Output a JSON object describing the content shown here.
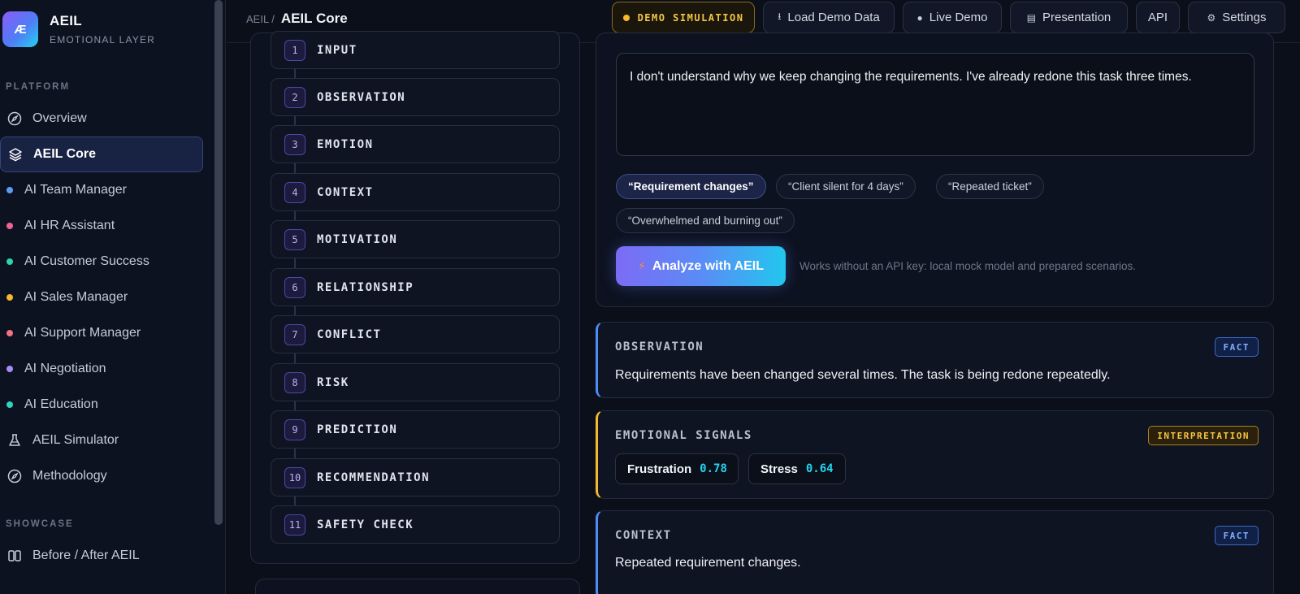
{
  "brand": {
    "logo_text": "Æ",
    "name": "AEIL",
    "subtitle": "EMOTIONAL LAYER"
  },
  "sidebar": {
    "platform_label": "PLATFORM",
    "platform_items": [
      {
        "label": "Overview",
        "icon": "compass-icon"
      },
      {
        "label": "AEIL Core",
        "icon": "layers-icon",
        "active": true
      },
      {
        "label": "AI Team Manager",
        "dot_color": "#5b9cf6"
      },
      {
        "label": "AI HR Assistant",
        "dot_color": "#f06292"
      },
      {
        "label": "AI Customer Success",
        "dot_color": "#2dd4a4"
      },
      {
        "label": "AI Sales Manager",
        "dot_color": "#f5b82e"
      },
      {
        "label": "AI Support Manager",
        "dot_color": "#f47283"
      },
      {
        "label": "AI Negotiation",
        "dot_color": "#a78bfa"
      },
      {
        "label": "AI Education",
        "dot_color": "#2dd4bf"
      },
      {
        "label": "AEIL Simulator",
        "icon": "flask-icon"
      },
      {
        "label": "Methodology",
        "icon": "compass-icon"
      }
    ],
    "showcase_label": "SHOWCASE",
    "showcase_items": [
      {
        "label": "Before / After AEIL",
        "icon": "split-columns-icon"
      }
    ]
  },
  "breadcrumb": {
    "parent": "AEIL",
    "separator": "/",
    "current": "AEIL Core"
  },
  "toolbar": {
    "demo_label": "DEMO SIMULATION",
    "load_label": "Load Demo Data",
    "live_label": "Live Demo",
    "presentation_label": "Presentation",
    "api_label": "API",
    "settings_label": "Settings"
  },
  "pipeline": {
    "steps": [
      {
        "num": "1",
        "label": "INPUT"
      },
      {
        "num": "2",
        "label": "OBSERVATION"
      },
      {
        "num": "3",
        "label": "EMOTION"
      },
      {
        "num": "4",
        "label": "CONTEXT"
      },
      {
        "num": "5",
        "label": "MOTIVATION"
      },
      {
        "num": "6",
        "label": "RELATIONSHIP"
      },
      {
        "num": "7",
        "label": "CONFLICT"
      },
      {
        "num": "8",
        "label": "RISK"
      },
      {
        "num": "9",
        "label": "PREDICTION"
      },
      {
        "num": "10",
        "label": "RECOMMENDATION"
      },
      {
        "num": "11",
        "label": "SAFETY CHECK"
      }
    ]
  },
  "input": {
    "message": "I don't understand why we keep changing the requirements. I've already redone this task three times.",
    "chips": [
      {
        "label": "“Requirement changes”",
        "active": true
      },
      {
        "label": "“Client silent for 4 days”"
      },
      {
        "label": "“Repeated ticket”"
      },
      {
        "label": "“Overwhelmed and burning out”"
      }
    ],
    "analyze_label": "Analyze with AEIL",
    "hint": "Works without an API key: local mock model and prepared scenarios."
  },
  "results": {
    "observation": {
      "title": "OBSERVATION",
      "tag": "FACT",
      "text": "Requirements have been changed several times. The task is being redone repeatedly."
    },
    "emotional_signals": {
      "title": "EMOTIONAL SIGNALS",
      "tag": "INTERPRETATION",
      "signals": [
        {
          "name": "Frustration",
          "value": "0.78"
        },
        {
          "name": "Stress",
          "value": "0.64"
        }
      ]
    },
    "context": {
      "title": "CONTEXT",
      "tag": "FACT",
      "text": "Repeated requirement changes."
    }
  },
  "colors": {
    "accent": "#4f8cf7",
    "fact_blue": "#7fb0ff",
    "interpretation_gold": "#f5c542",
    "signal_cyan": "#22d3ee",
    "background": "#0b0f19"
  }
}
